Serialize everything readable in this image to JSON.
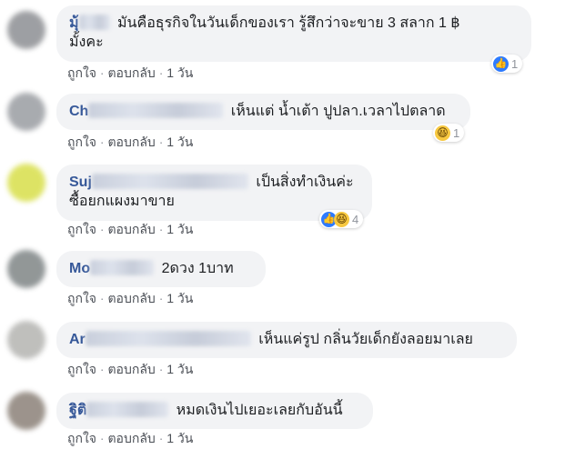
{
  "colors": {
    "bubble_bg": "#f2f3f5",
    "name_color": "#365899",
    "action_color": "#90949c",
    "like_blue": "#2e7bff",
    "haha_yellow": "#f7c840"
  },
  "actions": {
    "like": "ถูกใจ",
    "reply": "ตอบกลับ",
    "time": "1 วัน",
    "separator": "·"
  },
  "comments": [
    {
      "name_prefix": "มุ้",
      "text": "มันคือธุรกิจในวันเด็กของเรา รู้สึกว่าจะขาย 3 สลาก 1 ฿",
      "text_line2": "มั้งคะ",
      "reaction_icons": [
        "like-icon"
      ],
      "reaction_count": "1"
    },
    {
      "name_prefix": "Ch",
      "text": "เห็นแต่ น้ำเต้า ปูปลา.เวลาไปตลาด",
      "reaction_icons": [
        "haha-icon"
      ],
      "reaction_count": "1"
    },
    {
      "name_prefix": "Suj",
      "text": "เป็นสิ่งทำเงินค่ะ",
      "text_line2": "ซื้อยกแผงมาขาย",
      "reaction_icons": [
        "like-icon",
        "haha-icon"
      ],
      "reaction_count": "4"
    },
    {
      "name_prefix": "Mo",
      "text": "2ดวง 1บาท"
    },
    {
      "name_prefix": "Ar",
      "text": "เห็นแค่รูป กลิ่นวัยเด็กยังลอยมาเลย"
    },
    {
      "name_prefix": "ฐิติ",
      "text": "หมดเงินไปเยอะเลยกับอันนี้"
    }
  ]
}
